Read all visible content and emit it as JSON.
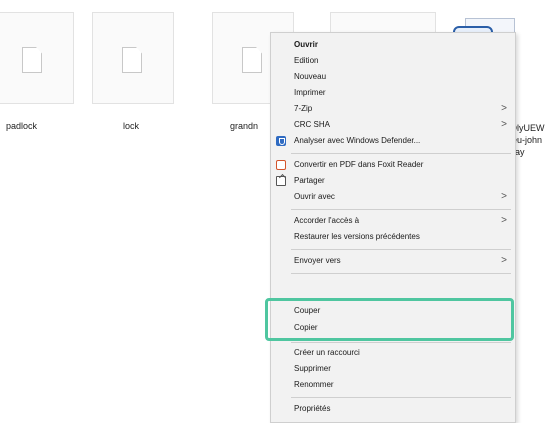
{
  "files": [
    {
      "label": "padlock"
    },
    {
      "label": "lock"
    },
    {
      "label": "grandn"
    },
    {
      "label": ""
    }
  ],
  "image_file": {
    "label": "OlyUEW\nleu-john\nday"
  },
  "context_menu": {
    "items": [
      {
        "label": "Ouvrir",
        "bold": true
      },
      {
        "label": "Edition"
      },
      {
        "label": "Nouveau"
      },
      {
        "label": "Imprimer"
      },
      {
        "label": "7-Zip",
        "submenu": true
      },
      {
        "label": "CRC SHA",
        "submenu": true
      },
      {
        "label": "Analyser avec Windows Defender...",
        "icon": "windows-defender-icon"
      },
      {
        "label": "Convertir en PDF dans Foxit Reader",
        "icon": "foxit-reader-icon"
      },
      {
        "label": "Partager",
        "icon": "share-icon"
      },
      {
        "label": "Ouvrir avec",
        "submenu": true
      },
      {
        "label": "Accorder l'accès à",
        "submenu": true
      },
      {
        "label": "Restaurer les versions précédentes"
      },
      {
        "label": "Envoyer vers",
        "submenu": true
      },
      {
        "label": "Couper"
      },
      {
        "label": "Copier"
      },
      {
        "label": "Créer un raccourci"
      },
      {
        "label": "Supprimer"
      },
      {
        "label": "Renommer"
      },
      {
        "label": "Propriétés"
      }
    ],
    "submenu_arrow": ">"
  },
  "highlight_color": "#4fc6a0"
}
